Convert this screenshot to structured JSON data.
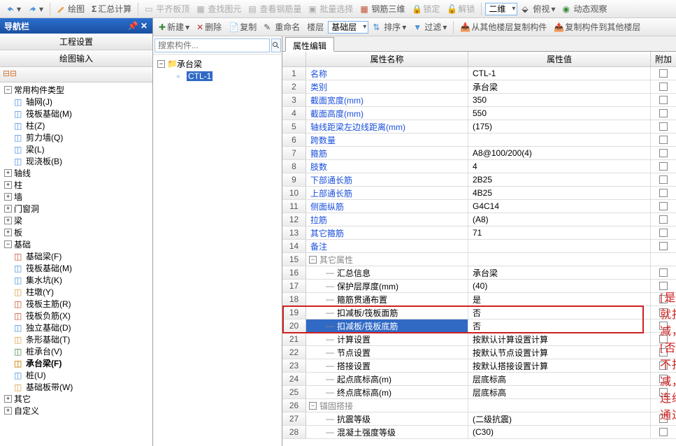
{
  "top_toolbar": {
    "draw": "绘图",
    "sum_calc": "汇总计算",
    "flat_top": "平齐板顶",
    "find_gy": "查找图元",
    "view_rebar": "查看钢筋量",
    "batch_sel": "批量选择",
    "rebar_3d": "钢筋三维",
    "lock": "锁定",
    "unlock": "解锁",
    "view2d": "二维",
    "bird": "俯视",
    "dyn": "动态观察"
  },
  "nav": {
    "title": "导航栏",
    "sec1": "工程设置",
    "sec2": "绘图输入",
    "groups": {
      "common": "常用构件类型",
      "axis": "轴线",
      "pillar": "柱",
      "wall": "墙",
      "door": "门窗洞",
      "beam": "梁",
      "board": "板",
      "base": "基础",
      "other": "其它",
      "custom": "自定义"
    },
    "common_items": [
      "轴网(J)",
      "筏板基础(M)",
      "柱(Z)",
      "剪力墙(Q)",
      "梁(L)",
      "现浇板(B)"
    ],
    "base_items": [
      "基础梁(F)",
      "筏板基础(M)",
      "集水坑(K)",
      "柱墩(Y)",
      "筏板主筋(R)",
      "筏板负筋(X)",
      "独立基础(D)",
      "条形基础(T)",
      "桩承台(V)",
      "承台梁(F)",
      "桩(U)",
      "基础板带(W)"
    ]
  },
  "mid": {
    "new": "新建",
    "del": "删除",
    "copy": "复制",
    "rename": "重命名",
    "floor": "楼层",
    "base_layer": "基础层",
    "sort": "排序",
    "filter": "过滤",
    "copy_from": "从其他楼层复制构件",
    "copy_to": "复制构件到其他楼层",
    "search_ph": "搜索构件...",
    "root": "承台梁",
    "child": "CTL-1"
  },
  "prop": {
    "tab": "属性编辑",
    "h_name": "属性名称",
    "h_val": "属性值",
    "h_ext": "附加",
    "rows": [
      {
        "n": 1,
        "name": "名称",
        "val": "CTL-1",
        "blue": true,
        "chk": false
      },
      {
        "n": 2,
        "name": "类别",
        "val": "承台梁",
        "blue": true,
        "chk": true
      },
      {
        "n": 3,
        "name": "截面宽度(mm)",
        "val": "350",
        "blue": true,
        "chk": true
      },
      {
        "n": 4,
        "name": "截面高度(mm)",
        "val": "550",
        "blue": true,
        "chk": true
      },
      {
        "n": 5,
        "name": "轴线距梁左边线距离(mm)",
        "val": "(175)",
        "blue": true,
        "chk": true
      },
      {
        "n": 6,
        "name": "跨数量",
        "val": "",
        "blue": true,
        "chk": true
      },
      {
        "n": 7,
        "name": "箍筋",
        "val": "A8@100/200(4)",
        "blue": true,
        "chk": true
      },
      {
        "n": 8,
        "name": "肢数",
        "val": "4",
        "blue": true,
        "chk": false
      },
      {
        "n": 9,
        "name": "下部通长筋",
        "val": "2B25",
        "blue": true,
        "chk": true
      },
      {
        "n": 10,
        "name": "上部通长筋",
        "val": "4B25",
        "blue": true,
        "chk": true
      },
      {
        "n": 11,
        "name": "侧面纵筋",
        "val": "G4C14",
        "blue": true,
        "chk": true
      },
      {
        "n": 12,
        "name": "拉筋",
        "val": "(A8)",
        "blue": true,
        "chk": true
      },
      {
        "n": 13,
        "name": "其它箍筋",
        "val": "71",
        "blue": true,
        "chk": false
      },
      {
        "n": 14,
        "name": "备注",
        "val": "",
        "blue": true,
        "chk": true
      },
      {
        "n": 15,
        "name": "其它属性",
        "val": "",
        "group": true
      },
      {
        "n": 16,
        "name": "汇总信息",
        "val": "承台梁",
        "indent": true,
        "chk": true
      },
      {
        "n": 17,
        "name": "保护层厚度(mm)",
        "val": "(40)",
        "indent": true,
        "chk": true
      },
      {
        "n": 18,
        "name": "箍筋贯通布置",
        "val": "是",
        "indent": true,
        "chk": true
      },
      {
        "n": 19,
        "name": "扣减板/筏板面筋",
        "val": "否",
        "indent": true,
        "chk": true,
        "hl": true
      },
      {
        "n": 20,
        "name": "扣减板/筏板底筋",
        "val": "否",
        "indent": true,
        "chk": true,
        "hl": true,
        "sel": true
      },
      {
        "n": 21,
        "name": "计算设置",
        "val": "按默认计算设置计算",
        "indent": true,
        "chk": false
      },
      {
        "n": 22,
        "name": "节点设置",
        "val": "按默认节点设置计算",
        "indent": true,
        "chk": false
      },
      {
        "n": 23,
        "name": "搭接设置",
        "val": "按默认搭接设置计算",
        "indent": true,
        "chk": false
      },
      {
        "n": 24,
        "name": "起点底标高(m)",
        "val": "层底标高",
        "indent": true,
        "chk": true
      },
      {
        "n": 25,
        "name": "终点底标高(m)",
        "val": "层底标高",
        "indent": true,
        "chk": true
      },
      {
        "n": 26,
        "name": "锚固搭接",
        "val": "",
        "group": true
      },
      {
        "n": 27,
        "name": "抗震等级",
        "val": "(二级抗震)",
        "indent": true,
        "chk": true
      },
      {
        "n": 28,
        "name": "混凝土强度等级",
        "val": "(C30)",
        "indent": true,
        "chk": true
      }
    ]
  },
  "annotation": "[是]就扣减，[否]不扣减，连续通过"
}
